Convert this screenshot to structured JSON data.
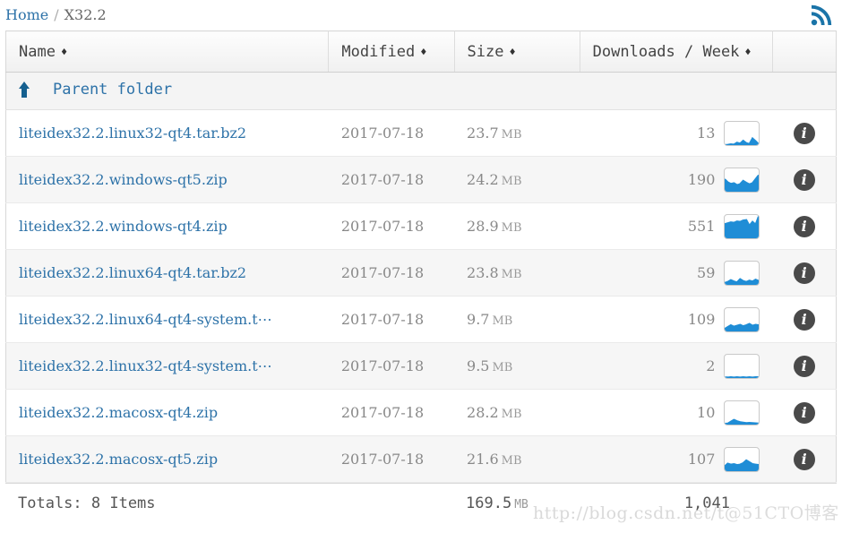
{
  "breadcrumb": {
    "home_label": "Home",
    "separator": "/",
    "current_label": "X32.2"
  },
  "rss": {
    "icon": "rss-icon",
    "title": "RSS feed"
  },
  "table": {
    "columns": [
      {
        "label": "Name",
        "sort_icon": "sort-both-icon"
      },
      {
        "label": "Modified",
        "sort_icon": "sort-both-icon"
      },
      {
        "label": "Size",
        "sort_icon": "sort-both-icon"
      },
      {
        "label": "Downloads / Week",
        "sort_icon": "sort-both-icon"
      },
      {
        "label": "",
        "sort_icon": ""
      }
    ],
    "sort_caret": "♦",
    "parent_folder": {
      "label": "Parent folder",
      "icon": "up-arrow-icon"
    },
    "rows": [
      {
        "name": "liteidex32.2.linux32-qt4.tar.bz2",
        "modified": "2017-07-18",
        "size": "23.7",
        "size_unit": "MB",
        "downloads": "13",
        "sparkline": "downloads-sparkline",
        "info_icon": "info-icon"
      },
      {
        "name": "liteidex32.2.windows-qt5.zip",
        "modified": "2017-07-18",
        "size": "24.2",
        "size_unit": "MB",
        "downloads": "190",
        "sparkline": "downloads-sparkline",
        "info_icon": "info-icon"
      },
      {
        "name": "liteidex32.2.windows-qt4.zip",
        "modified": "2017-07-18",
        "size": "28.9",
        "size_unit": "MB",
        "downloads": "551",
        "sparkline": "downloads-sparkline",
        "info_icon": "info-icon"
      },
      {
        "name": "liteidex32.2.linux64-qt4.tar.bz2",
        "modified": "2017-07-18",
        "size": "23.8",
        "size_unit": "MB",
        "downloads": "59",
        "sparkline": "downloads-sparkline",
        "info_icon": "info-icon"
      },
      {
        "name": "liteidex32.2.linux64-qt4-system.t⋯",
        "modified": "2017-07-18",
        "size": "9.7",
        "size_unit": "MB",
        "downloads": "109",
        "sparkline": "downloads-sparkline",
        "info_icon": "info-icon"
      },
      {
        "name": "liteidex32.2.linux32-qt4-system.t⋯",
        "modified": "2017-07-18",
        "size": "9.5",
        "size_unit": "MB",
        "downloads": "2",
        "sparkline": "downloads-sparkline",
        "info_icon": "info-icon"
      },
      {
        "name": "liteidex32.2.macosx-qt4.zip",
        "modified": "2017-07-18",
        "size": "28.2",
        "size_unit": "MB",
        "downloads": "10",
        "sparkline": "downloads-sparkline",
        "info_icon": "info-icon"
      },
      {
        "name": "liteidex32.2.macosx-qt5.zip",
        "modified": "2017-07-18",
        "size": "21.6",
        "size_unit": "MB",
        "downloads": "107",
        "sparkline": "downloads-sparkline",
        "info_icon": "info-icon"
      }
    ],
    "totals": {
      "label": "Totals: 8 Items",
      "size": "169.5",
      "size_unit": "MB",
      "downloads": "1,041"
    }
  },
  "watermark": {
    "url": "http://blog.csdn.net/t",
    "tag": "@51CTO博客"
  },
  "colors": {
    "link": "#2d72a8",
    "sparkline": "#1f8dd6",
    "info_badge": "#4a4a4a",
    "header_text": "#444444",
    "body_text": "#888888",
    "row_alt": "#f6f6f6",
    "border": "#e0e0e0"
  }
}
